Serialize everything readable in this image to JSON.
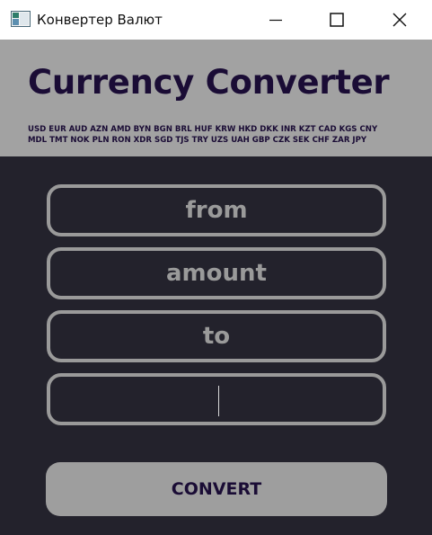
{
  "window": {
    "title": "Конвертер Валют"
  },
  "header": {
    "title": "Currency Converter",
    "codes_line1": "USD EUR AUD AZN AMD BYN BGN BRL HUF KRW HKD DKK INR KZT CAD KGS CNY",
    "codes_line2": "MDL TMT NOK PLN RON XDR SGD TJS TRY UZS UAH GBP CZK SEK CHF ZAR JPY"
  },
  "form": {
    "from_placeholder": "from",
    "amount_placeholder": "amount",
    "to_placeholder": "to",
    "result_value": ""
  },
  "actions": {
    "convert_label": "CONVERT"
  },
  "colors": {
    "background": "#23222c",
    "header": "#a2a2a2",
    "accent_text": "#1a0c35",
    "field_border": "#9a9a9a"
  },
  "icons": {
    "app": "window-app-icon",
    "minimize": "minimize-icon",
    "maximize": "maximize-icon",
    "close": "close-icon"
  }
}
